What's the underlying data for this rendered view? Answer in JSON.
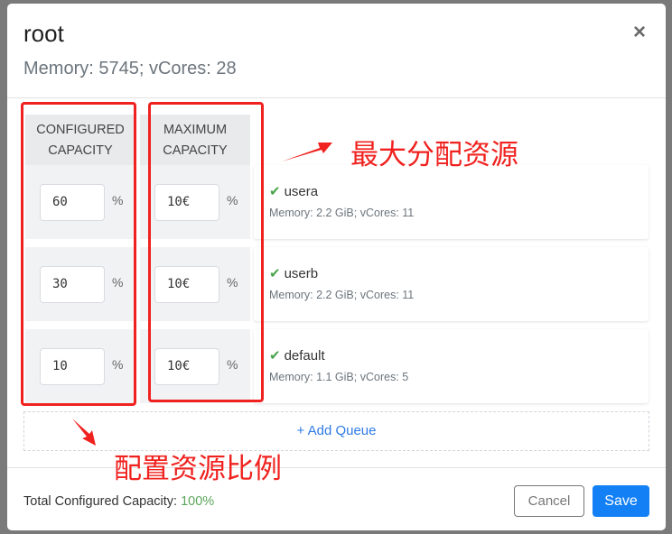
{
  "dialog": {
    "title": "root",
    "subtitle": "Memory: 5745; vCores: 28",
    "close_icon": "×"
  },
  "columns": {
    "configured": "CONFIGURED CAPACITY",
    "maximum": "MAXIMUM CAPACITY"
  },
  "queues": [
    {
      "name": "usera",
      "configured": "60",
      "maximum": "10€",
      "unit": "%",
      "resources": "Memory: 2.2 GiB; vCores: 11",
      "status_icon": "✔"
    },
    {
      "name": "userb",
      "configured": "30",
      "maximum": "10€",
      "unit": "%",
      "resources": "Memory: 2.2 GiB; vCores: 11",
      "status_icon": "✔"
    },
    {
      "name": "default",
      "configured": "10",
      "maximum": "10€",
      "unit": "%",
      "resources": "Memory: 1.1 GiB; vCores: 5",
      "status_icon": "✔"
    }
  ],
  "add_queue_label": "+ Add Queue",
  "footer": {
    "total_label": "Total Configured Capacity: ",
    "total_value": "100%",
    "cancel_label": "Cancel",
    "save_label": "Save"
  },
  "annotations": {
    "max_label": "最大分配资源",
    "ratio_label": "配置资源比例",
    "color": "#f0221f"
  }
}
